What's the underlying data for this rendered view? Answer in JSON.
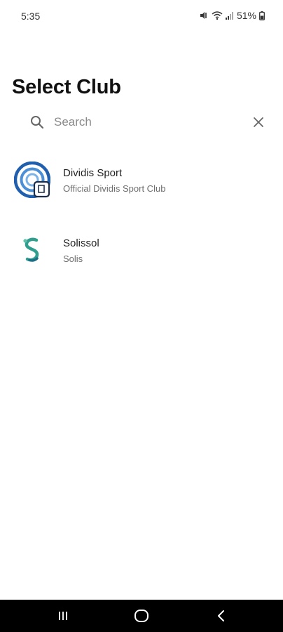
{
  "status_bar": {
    "time": "5:35",
    "battery": "51%",
    "icons": [
      "mute-icon",
      "wifi-icon",
      "signal-icon",
      "battery-icon"
    ]
  },
  "page": {
    "title": "Select Club"
  },
  "search": {
    "placeholder": "Search",
    "value": "",
    "search_icon": "search-icon",
    "clear_icon": "close-icon"
  },
  "clubs": [
    {
      "name": "Dividis Sport",
      "subtitle": "Official Dividis Sport Club",
      "logo": "dividis-logo-icon",
      "logo_color": "#1f5fae"
    },
    {
      "name": "Solissol",
      "subtitle": "Solis",
      "logo": "solissol-logo-icon",
      "logo_color": "#2f9e8f"
    }
  ],
  "nav_bar": {
    "buttons": [
      "recent-apps-icon",
      "home-icon",
      "back-icon"
    ]
  },
  "colors": {
    "background": "#ffffff",
    "nav_bar": "#000000",
    "title": "#111111",
    "subtitle": "#6f6f6f"
  }
}
